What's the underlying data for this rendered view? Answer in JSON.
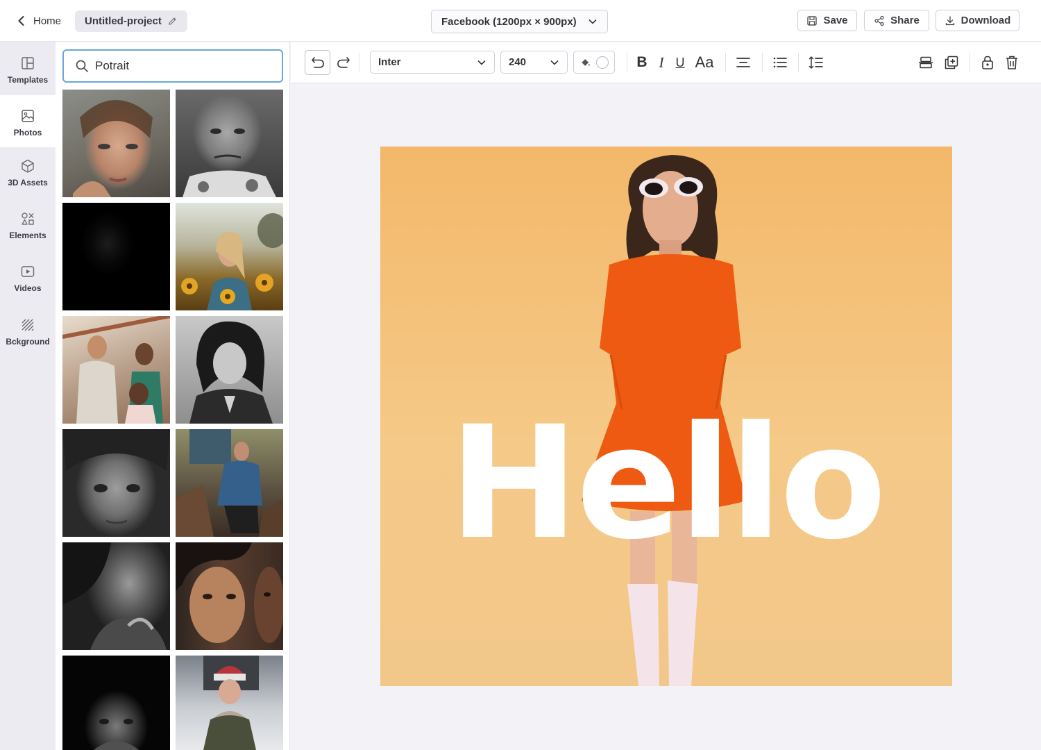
{
  "header": {
    "home_label": "Home",
    "project_name": "Untitled-project",
    "canvas_size": "Facebook (1200px × 900px)",
    "save_label": "Save",
    "share_label": "Share",
    "download_label": "Download"
  },
  "rail": {
    "items": [
      {
        "label": "Templates",
        "icon": "templates-icon"
      },
      {
        "label": "Photos",
        "icon": "photo-icon"
      },
      {
        "label": "3D Assets",
        "icon": "cube-icon"
      },
      {
        "label": "Elements",
        "icon": "shapes-icon"
      },
      {
        "label": "Videos",
        "icon": "video-icon"
      },
      {
        "label": "Bckground",
        "icon": "background-icon"
      }
    ],
    "active": "Photos"
  },
  "search": {
    "value": "Potrait",
    "icon": "search-icon"
  },
  "photos": {
    "count_visible": 12,
    "items": [
      {
        "subject": "freckled-woman-portrait"
      },
      {
        "subject": "elderly-man-bw"
      },
      {
        "subject": "dark-boy-portrait"
      },
      {
        "subject": "woman-sunflowers"
      },
      {
        "subject": "friends-hello-shirt"
      },
      {
        "subject": "curly-woman-bw"
      },
      {
        "subject": "child-bw-closeup"
      },
      {
        "subject": "woman-woodpile"
      },
      {
        "subject": "woman-shadow-bw"
      },
      {
        "subject": "two-faces-closeup"
      },
      {
        "subject": "bearded-man-dark"
      },
      {
        "subject": "woman-beanie-snow"
      }
    ]
  },
  "toolbar": {
    "font": "Inter",
    "font_size": "240",
    "text_color": "#ffffff",
    "icons": [
      "undo-icon",
      "redo-icon",
      "fill-color-icon",
      "bold-icon",
      "italic-icon",
      "underline-icon",
      "text-case-icon",
      "align-center-icon",
      "list-icon",
      "line-spacing-icon",
      "align-middle-icon",
      "duplicate-icon",
      "lock-icon",
      "delete-icon"
    ],
    "bold_label": "B",
    "italic_label": "I",
    "underline_label": "U",
    "case_label": "Aa"
  },
  "canvas": {
    "text": "Hello",
    "background": "#f4c17f",
    "dress_color": "#ee5a12"
  }
}
